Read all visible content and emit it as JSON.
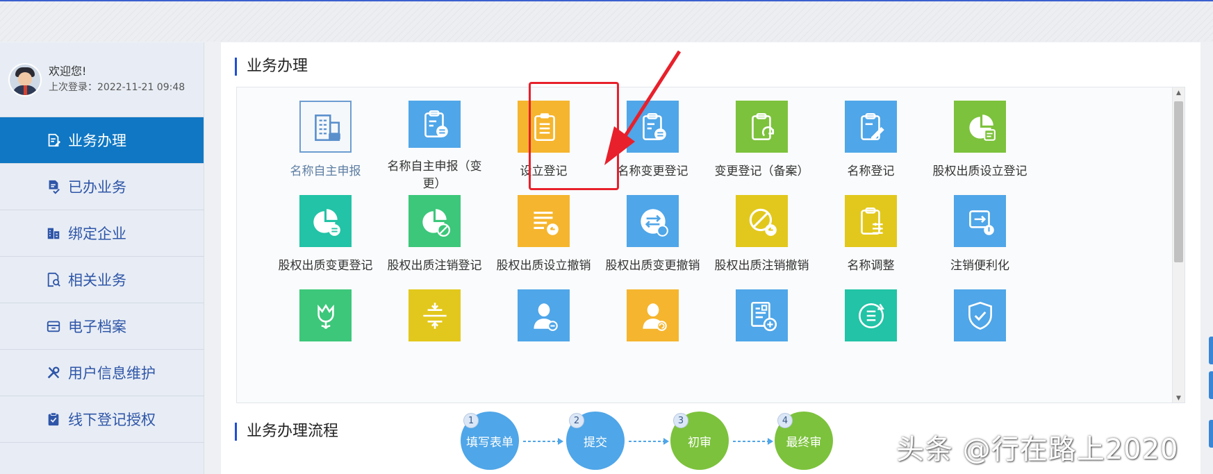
{
  "header": {},
  "sidebar": {
    "welcome": "欢迎您!",
    "last_login": "上次登录：2022-11-21 09:48",
    "items": [
      {
        "label": "业务办理",
        "icon": "edit-document-icon",
        "active": true
      },
      {
        "label": "已办业务",
        "icon": "document-check-icon",
        "active": false
      },
      {
        "label": "绑定企业",
        "icon": "building-icon",
        "active": false
      },
      {
        "label": "相关业务",
        "icon": "document-search-icon",
        "active": false
      },
      {
        "label": "电子档案",
        "icon": "archive-box-icon",
        "active": false
      },
      {
        "label": "用户信息维护",
        "icon": "tools-icon",
        "active": false
      },
      {
        "label": "线下登记授权",
        "icon": "clipboard-check-icon",
        "active": false
      }
    ]
  },
  "main": {
    "section1_title": "业务办理",
    "section2_title": "业务办理流程",
    "services": [
      {
        "label": "名称自主申报",
        "icon": "building-badge-icon",
        "color": "#ffffff"
      },
      {
        "label": "名称自主申报（变更）",
        "icon": "clipboard-swap-icon",
        "color": "#4fa6e8"
      },
      {
        "label": "设立登记",
        "icon": "clipboard-icon",
        "color": "#f5b52e"
      },
      {
        "label": "名称变更登记",
        "icon": "clipboard-swap-icon",
        "color": "#4fa6e8"
      },
      {
        "label": "变更登记（备案）",
        "icon": "clipboard-refresh-icon",
        "color": "#7cc23c"
      },
      {
        "label": "名称登记",
        "icon": "clipboard-pen-icon",
        "color": "#4fa6e8"
      },
      {
        "label": "股权出质设立登记",
        "icon": "pie-chart-doc-icon",
        "color": "#7cc23c"
      },
      {
        "label": "股权出质变更登记",
        "icon": "pie-chart-swap-icon",
        "color": "#22c3a6"
      },
      {
        "label": "股权出质注销登记",
        "icon": "pie-chart-cancel-icon",
        "color": "#3cc77a"
      },
      {
        "label": "股权出质设立撤销",
        "icon": "list-undo-icon",
        "color": "#f5b52e"
      },
      {
        "label": "股权出质变更撤销",
        "icon": "swap-undo-icon",
        "color": "#4fa6e8"
      },
      {
        "label": "股权出质注销撤销",
        "icon": "cancel-undo-icon",
        "color": "#e2c81c"
      },
      {
        "label": "名称调整",
        "icon": "clipboard-adjust-icon",
        "color": "#e2c81c"
      },
      {
        "label": "注销便利化",
        "icon": "logout-icon",
        "color": "#4fa6e8"
      },
      {
        "label": "",
        "icon": "tulip-icon",
        "color": "#3cc77a"
      },
      {
        "label": "",
        "icon": "merge-icon",
        "color": "#e2c81c"
      },
      {
        "label": "",
        "icon": "person-minus-icon",
        "color": "#4fa6e8"
      },
      {
        "label": "",
        "icon": "person-refresh-icon",
        "color": "#f5b52e"
      },
      {
        "label": "",
        "icon": "doc-plus-icon",
        "color": "#4fa6e8"
      },
      {
        "label": "",
        "icon": "list-cycle-icon",
        "color": "#22c3a6"
      },
      {
        "label": "",
        "icon": "shield-check-icon",
        "color": "#4fa6e8"
      }
    ],
    "flow": [
      {
        "num": "1",
        "label": "填写表单",
        "color": "#4fa6e8"
      },
      {
        "num": "2",
        "label": "提交",
        "color": "#4fa6e8"
      },
      {
        "num": "3",
        "label": "初审",
        "color": "#7cc23c"
      },
      {
        "num": "4",
        "label": "最终审",
        "color": "#7cc23c"
      }
    ],
    "flow_connector_color": "#4fa6e8",
    "highlight_color": "#e8202b"
  },
  "watermark": "头条 @行在路上2020"
}
